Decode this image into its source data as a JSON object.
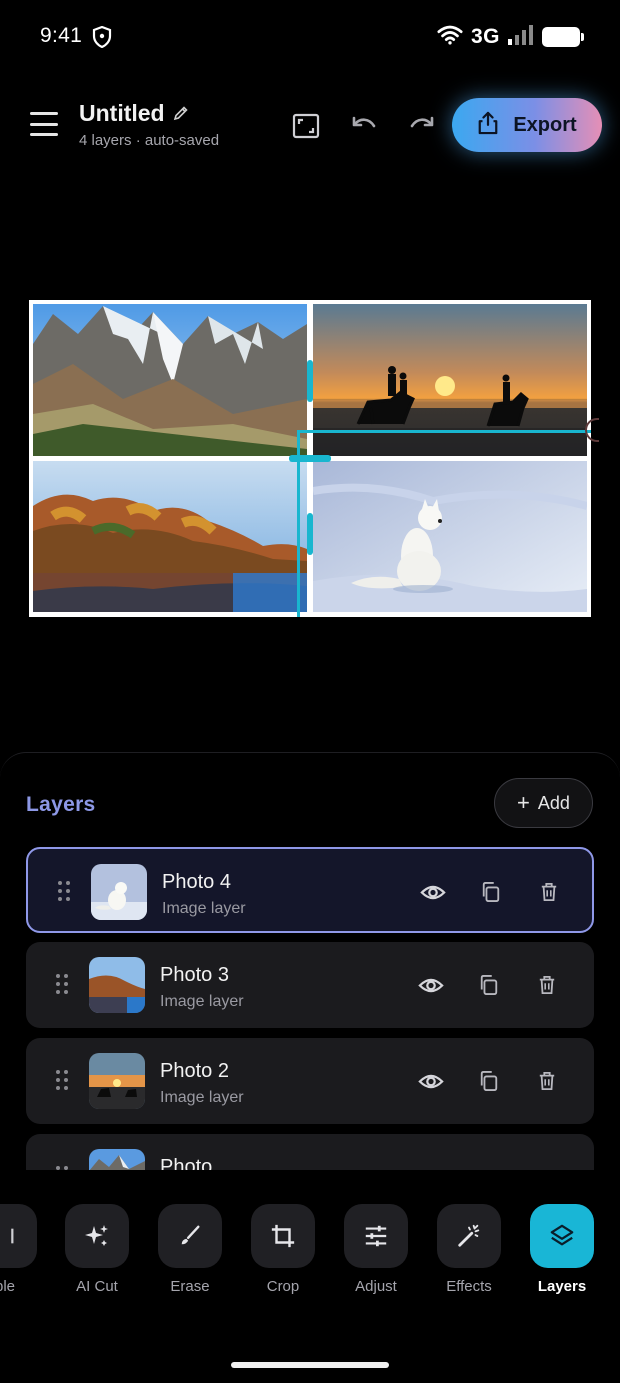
{
  "status_bar": {
    "time": "9:41",
    "network": "3G"
  },
  "header": {
    "title": "Untitled",
    "subtitle": "4 layers · auto-saved",
    "export_label": "Export",
    "accent_gradient": [
      "#3ba8f0",
      "#7b8fe6",
      "#e58fb6"
    ]
  },
  "canvas": {
    "photos": [
      {
        "name": "mountains"
      },
      {
        "name": "sunset-horses"
      },
      {
        "name": "autumn-lake"
      },
      {
        "name": "arctic-fox"
      }
    ]
  },
  "layers_panel": {
    "title": "Layers",
    "add_label": "Add",
    "accent_color": "#8d98e6",
    "layers": [
      {
        "name": "Photo 4",
        "type": "Image layer",
        "selected": true
      },
      {
        "name": "Photo 3",
        "type": "Image layer",
        "selected": false
      },
      {
        "name": "Photo 2",
        "type": "Image layer",
        "selected": false
      },
      {
        "name": "Photo",
        "type": "",
        "selected": false
      }
    ]
  },
  "toolbar": {
    "tools": [
      {
        "label": "ble",
        "icon": "partial-tool-icon"
      },
      {
        "label": "AI Cut",
        "icon": "sparkles-icon"
      },
      {
        "label": "Erase",
        "icon": "brush-icon"
      },
      {
        "label": "Crop",
        "icon": "crop-icon"
      },
      {
        "label": "Adjust",
        "icon": "sliders-icon"
      },
      {
        "label": "Effects",
        "icon": "magic-wand-icon"
      },
      {
        "label": "Layers",
        "icon": "layers-icon",
        "active": true
      }
    ],
    "active_color": "#19b6d6"
  }
}
